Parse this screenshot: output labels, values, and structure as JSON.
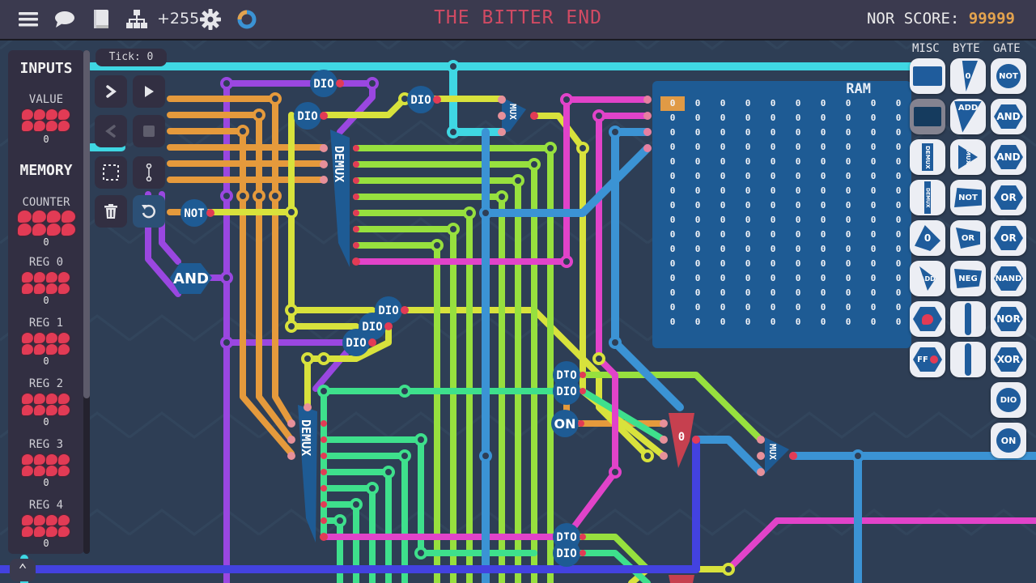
{
  "topbar": {
    "menu_icon": "hamburger-menu-icon",
    "chat_icon": "speech-bubble-icon",
    "manual_icon": "book-icon",
    "hierarchy_icon": "hierarchy-icon",
    "component_count": "+255",
    "settings_icon": "gear-icon",
    "loading_icon": "progress-ring-icon",
    "title": "THE BITTER END",
    "score_label": "NOR SCORE:",
    "score_value": "99999"
  },
  "sidebar": {
    "inputs_title": "INPUTS",
    "inputs": [
      {
        "label": "VALUE",
        "value": "0"
      }
    ],
    "memory_title": "MEMORY",
    "memory": [
      {
        "label": "COUNTER",
        "value": "0"
      },
      {
        "label": "REG 0",
        "value": "0"
      },
      {
        "label": "REG 1",
        "value": "0"
      },
      {
        "label": "REG 2",
        "value": "0"
      },
      {
        "label": "REG 3",
        "value": "0"
      },
      {
        "label": "REG 4",
        "value": "0"
      }
    ]
  },
  "controls": {
    "tick_label": "Tick: 0",
    "step": "step-forward-icon",
    "play": "play-icon",
    "step_back": "step-back-icon",
    "stop": "stop-icon",
    "select": "selection-box-icon",
    "wire": "wire-tool-icon",
    "delete": "trash-icon",
    "undo": "undo-icon"
  },
  "palette": {
    "headers": [
      "MISC",
      "BYTE",
      "GATE"
    ],
    "misc": [
      "Display",
      "Screen",
      "DEMUX",
      "DEMUX",
      "Const 0",
      "ADD",
      "Register",
      "FF"
    ],
    "byte": [
      "0",
      "ADD",
      "MUX",
      "NOT",
      "OR",
      "NEG",
      "Splitter",
      "Maker"
    ],
    "gate": [
      "NOT",
      "AND",
      "AND",
      "OR",
      "OR",
      "NAND",
      "NOR",
      "XOR",
      "DIO",
      "ON"
    ]
  },
  "ram": {
    "title": "RAM",
    "rows": 16,
    "cols": 10,
    "fill_value": "0",
    "highlight_index": 0
  },
  "circuit_labels": {
    "dio": "DIO",
    "not": "NOT",
    "and": "AND",
    "demux": "DEMUX",
    "mux": "MUX",
    "on": "ON",
    "const": "0"
  },
  "colors": {
    "title": "#d14a63",
    "score": "#e3a34e",
    "bit_off": "#e23b55",
    "wire_cyan": "#3fd7e3",
    "wire_purple": "#9a47e0",
    "wire_orange": "#e59a3c",
    "wire_yellow": "#d8e23c",
    "wire_lime": "#97e03e",
    "wire_green": "#3ee08c",
    "wire_magenta": "#e143c9",
    "wire_blue": "#3b93d4",
    "wire_indigo": "#4342e0"
  }
}
